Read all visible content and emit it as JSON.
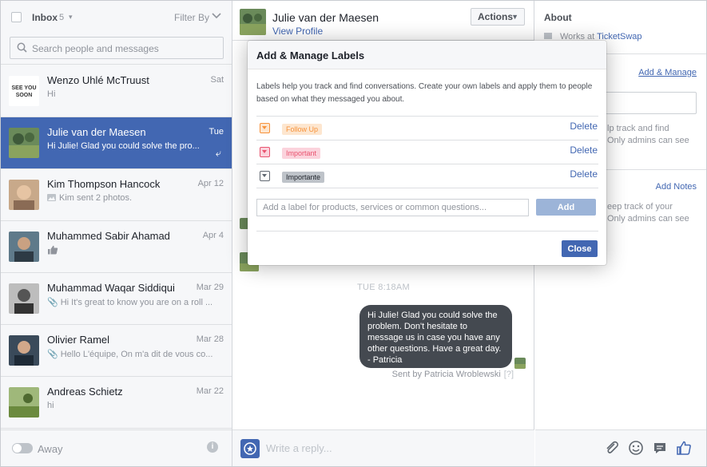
{
  "inbox": {
    "label": "Inbox",
    "count": "5",
    "filter_label": "Filter By",
    "search_placeholder": "Search people and messages"
  },
  "threads": [
    {
      "name": "Wenzo Uhlé McTruust",
      "date": "Sat",
      "snippet": "Hi",
      "avatar_text": "SEE YOU SOON"
    },
    {
      "name": "Julie van der Maesen",
      "date": "Tue",
      "snippet": "Hi Julie! Glad you could solve the pro..."
    },
    {
      "name": "Kim Thompson Hancock",
      "date": "Apr 12",
      "snippet": "Kim sent 2 photos."
    },
    {
      "name": "Muhammed Sabir Ahamad",
      "date": "Apr 4",
      "snippet": ""
    },
    {
      "name": "Muhammad Waqar Siddiqui",
      "date": "Mar 29",
      "snippet": "Hi It's great to know you are on a roll ..."
    },
    {
      "name": "Olivier Ramel",
      "date": "Mar 28",
      "snippet": "Hello L'équipe, On m'a dit de vous co..."
    },
    {
      "name": "Andreas Schietz",
      "date": "Mar 22",
      "snippet": "hi"
    }
  ],
  "left_footer": {
    "away_label": "Away"
  },
  "conversation": {
    "name": "Julie van der Maesen",
    "profile_link": "View Profile",
    "actions_label": "Actions",
    "timestamp": "TUE 8:18AM",
    "message_lines": [
      "Hi Julie! Glad you could solve the",
      "problem. Don't hesitate to",
      "message us in case you have any",
      "other questions. Have a great day.",
      "- Patricia"
    ],
    "sent_by": "Sent by Patricia Wroblewski",
    "sent_by_help": "[?]",
    "reply_placeholder": "Write a reply..."
  },
  "about": {
    "title": "About",
    "works_prefix": "Works at",
    "company": "TicketSwap",
    "add_manage": "Add & Manage",
    "labels_help_1": "lp track and find",
    "labels_help_2": "Only admins can see",
    "add_notes": "Add Notes",
    "notes_help_1": "eep track of your",
    "notes_help_2": "Only admins can see"
  },
  "modal": {
    "title": "Add & Manage Labels",
    "description": "Labels help you track and find conversations. Create your own labels and apply them to people based on what they messaged you about.",
    "labels": [
      {
        "name": "Follow Up",
        "color": "#f7923a",
        "bg": "#fde6cf",
        "text_color": "#f7923a"
      },
      {
        "name": "Important",
        "color": "#e9536f",
        "bg": "#fbd3dc",
        "text_color": "#e9536f"
      },
      {
        "name": "Importante",
        "color": "#606770",
        "bg": "#bec3c9",
        "text_color": "#1d2129"
      }
    ],
    "delete_label": "Delete",
    "input_placeholder": "Add a label for products, services or common questions...",
    "add_label": "Add",
    "close_label": "Close"
  },
  "colors": {
    "brand": "#4267b2",
    "active_thread": "#4267b2",
    "bubble": "#444950"
  }
}
